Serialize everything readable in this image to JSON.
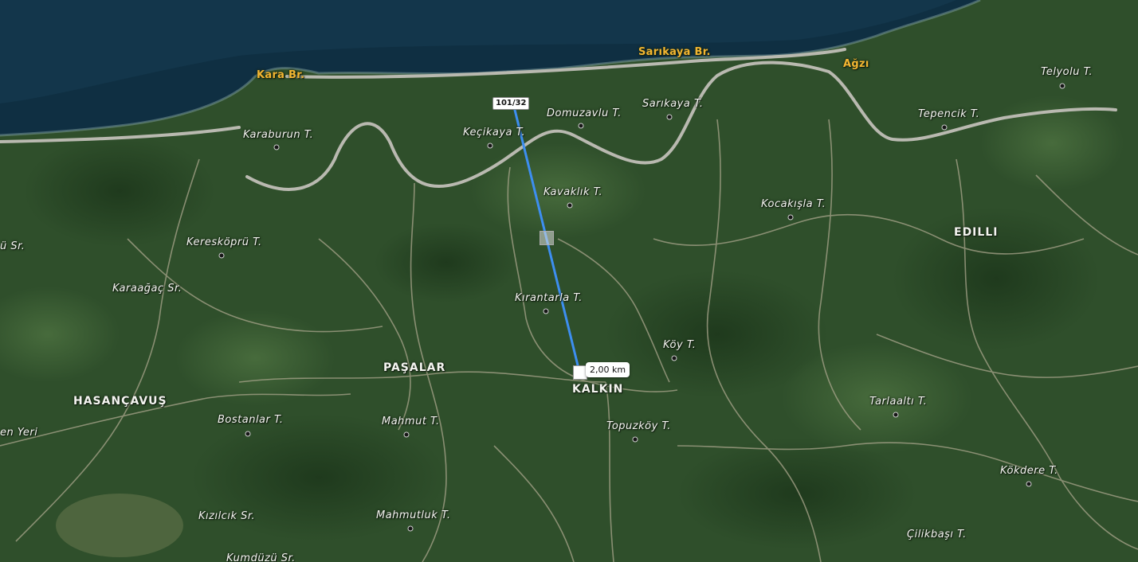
{
  "map": {
    "places": {
      "kara_br": "Kara Br.",
      "sarikaya_br": "Sarıkaya Br.",
      "agzi": "Ağzı",
      "telyolu": "Telyolu T.",
      "tepencik": "Tepencik T.",
      "karaburun": "Karaburun T.",
      "kecikaya": "Keçikaya T.",
      "domuzavlu": "Domuzavlu T.",
      "sarikaya_t": "Sarıkaya T.",
      "kavaklik": "Kavaklık T.",
      "kocakisla": "Kocakışla T.",
      "edilli": "EDILLI",
      "u_sr": "ü Sr.",
      "kereskopru": "Keresköprü T.",
      "karaagac": "Karaağaç Sr.",
      "kirantarla": "Kırantarla T.",
      "koy": "Köy T.",
      "pasalar": "PAŞALAR",
      "kalkin": "KALKIN",
      "hasancavus": "HASANÇAVUŞ",
      "bostanlar": "Bostanlar T.",
      "mahmut": "Mahmut T.",
      "tarlaalti": "Tarlaaltı T.",
      "topuzkoy": "Topuzköy T.",
      "en_yeri": "en Yeri",
      "kokdere": "Kökdere T.",
      "kizilcik": "Kızılcık Sr.",
      "mahmutluk": "Mahmutluk T.",
      "kumduzu": "Kumdüzü Sr.",
      "cilikbasi": "Çilikbaşı T."
    },
    "measurement": {
      "start_tag": "101/32",
      "distance": "2,00 km",
      "line_color": "#3d8ef0"
    },
    "colors": {
      "sea": "#0f2f42",
      "land": "#2f4f2b",
      "road": "#b9b9b0",
      "coastal_label": "#f2b531"
    }
  }
}
